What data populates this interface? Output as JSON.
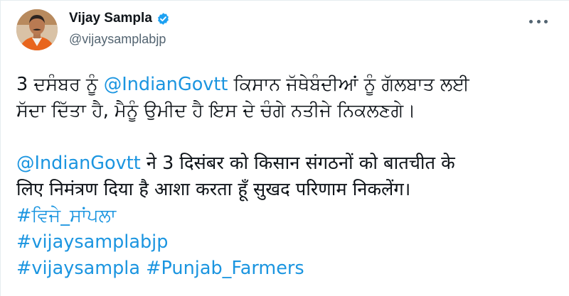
{
  "author": {
    "name": "Vijay Sampla",
    "handle": "@vijaysamplabjp",
    "verified": true
  },
  "icons": {
    "verified": "verified-badge-icon",
    "more": "more-options-icon"
  },
  "colors": {
    "link": "#1b95e0",
    "verified": "#1da1f2",
    "text": "#0f1419",
    "secondary": "#536471"
  },
  "tweet": {
    "punjabi_line1_prefix": "3 ਦਸੰਬਰ ਨੂੰ ",
    "punjabi_mention": "@IndianGovtt",
    "punjabi_line1_suffix": " ਕਿਸਾਨ ਜੱਥੇਬੰਦੀਆਂ ਨੂੰ ਗੱਲਬਾਤ ਲਈ",
    "punjabi_line2": "ਸੱਦਾ ਦਿੱਤਾ ਹੈ, ਮੈਨੂੰ ਉਮੀਦ ਹੈ ਇਸ ਦੇ ਚੰਗੇ ਨਤੀਜੇ ਨਿਕਲਣਗੇ।",
    "hindi_mention": "@IndianGovtt",
    "hindi_line1_suffix": " ने 3 दिसंबर को किसान संगठनों को बातचीत के",
    "hindi_line2": "लिए निमंत्रण दिया है आशा करता हूँ सुखद परिणाम निकलेंग।",
    "hashtag1": "#ਵਿਜੇ_ਸਾਂਪਲਾ",
    "hashtag2": "#vijaysamplabjp",
    "hashtag3": "#vijaysampla",
    "hashtag4": "#Punjab_Farmers"
  }
}
